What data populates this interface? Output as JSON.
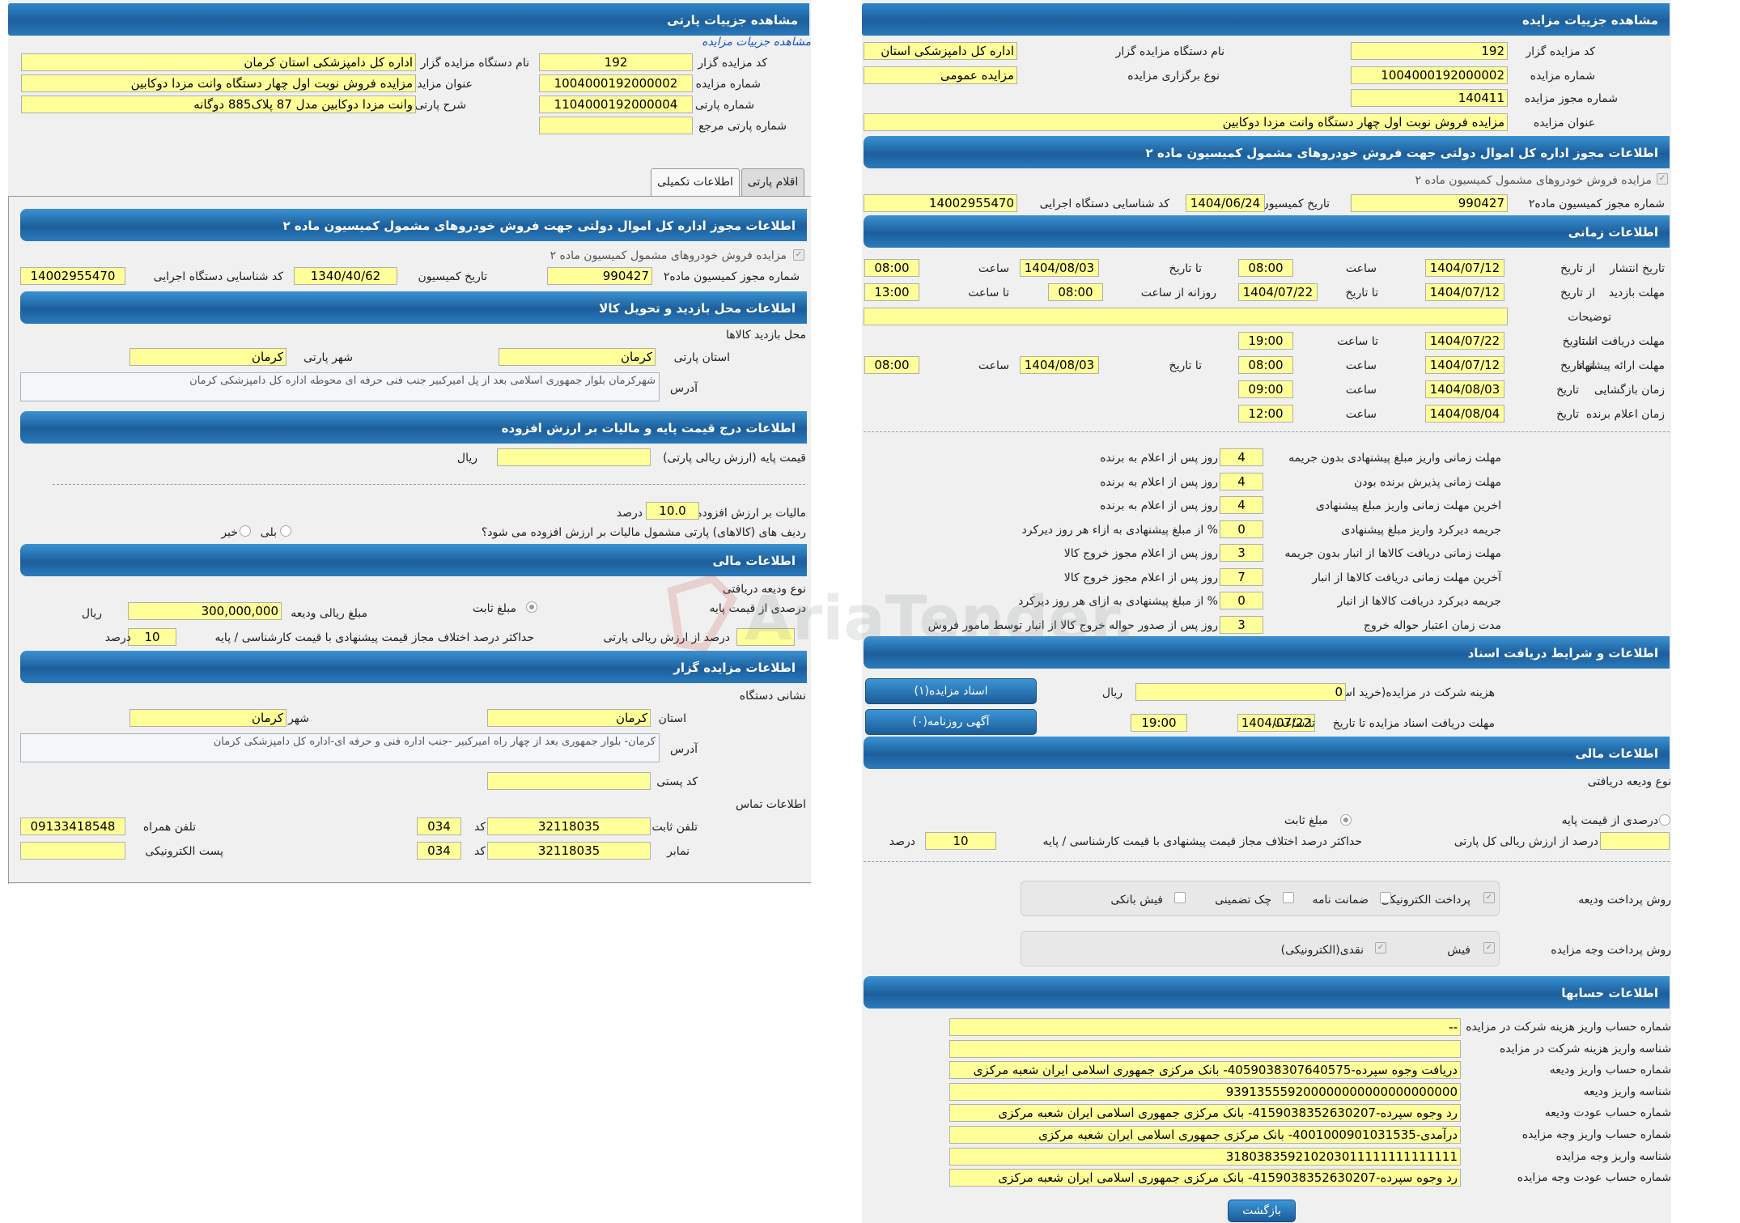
{
  "left": {
    "title": "مشاهده جزییات پارتی",
    "link": "مشاهده جزییات مزایده",
    "fields": {
      "org_name_label": "نام دستگاه مزایده گزار",
      "org_name": "اداره کل دامپزشکی استان کرمان",
      "auction_code_label": "کد مزایده گزار",
      "auction_code": "192",
      "auction_title_label": "عنوان مزایده",
      "auction_title": "مزایده فروش نوبت اول چهار دستگاه وانت مزدا دوکابین",
      "auction_no_label": "شماره مزایده",
      "auction_no": "1004000192000002",
      "party_desc_label": "شرح پارتی",
      "party_desc": "وانت مزدا دوکابین مدل 87 پلاک885 دوگانه",
      "party_no_label": "شماره پارتی",
      "party_no": "1104000192000004",
      "ref_party_label": "شماره پارتی مرجع",
      "ref_party": ""
    },
    "tabs": {
      "items": "اقلام پارتی",
      "extra": "اطلاعات تکمیلی"
    },
    "permit": {
      "header": "اطلاعات مجوز اداره کل اموال دولتی جهت فروش خودروهای مشمول کمیسیون ماده ۲",
      "check_label": "مزایده فروش خودروهای مشمول کمیسیون ماده ۲",
      "commission_no_label": "شماره مجوز کمیسیون ماده۲",
      "commission_no": "990427",
      "commission_date_label": "تاریخ کمیسیون",
      "commission_date": "1340/40/62",
      "exec_id_label": "کد شناسایی دستگاه اجرایی",
      "exec_id": "14002955470"
    },
    "visit": {
      "header": "اطلاعات محل بازدید و تحویل کالا",
      "place_label": "محل بازدید کالاها",
      "province_label": "استان پارتی",
      "province": "کرمان",
      "city_label": "شهر پارتی",
      "city": "کرمان",
      "address_label": "آدرس",
      "address": "شهرکرمان بلوار جمهوری اسلامی بعد از پل امیرکبیر جنب فنی حرفه ای محوطه اداره کل دامپزشکی کرمان"
    },
    "price": {
      "header": "اطلاعات درج قیمت پایه و مالیات بر ارزش افزوده",
      "base_label": "قیمت پایه (ارزش ریالی پارتی)",
      "base_value": "",
      "rial": "ریال",
      "vat_label": "مالیات بر ارزش افزوده",
      "vat_value": "10.0",
      "percent": "درصد",
      "vat_question": "ردیف های (کالاهای) پارتی مشمول مالیات بر ارزش افزوده می شود؟",
      "yes": "بلی",
      "no": "خیر"
    },
    "finance": {
      "header": "اطلاعات مالی",
      "deposit_type_label": "نوع ودیعه دریافتی",
      "percent_base": "درصدی از قیمت پایه",
      "fixed": "مبلغ ثابت",
      "deposit_amount_label": "مبلغ ریالی ودیعه",
      "deposit_amount": "300,000,000",
      "rial": "ریال",
      "percent_party_label": "درصد از ارزش ریالی پارتی",
      "percent_party": "",
      "max_diff_label": "حداکثر درصد اختلاف مجاز قیمت پیشنهادی با قیمت کارشناسی / پایه",
      "max_diff": "10",
      "percent": "درصد"
    },
    "org": {
      "header": "اطلاعات مزایده گزار",
      "address_title": "نشانی دستگاه",
      "province_label": "استان",
      "province": "کرمان",
      "city_label": "شهر",
      "city": "کرمان",
      "address_label": "آدرس",
      "address": "کرمان- بلوار جمهوری بعد از چهار راه امیرکبیر -جنب اداره فنی و حرفه ای-اداره کل دامپزشکی کرمان",
      "postal_label": "کد پستی",
      "postal": "",
      "contact_label": "اطلاعات تماس",
      "phone_label": "تلفن ثابت",
      "phone": "32118035",
      "code_label": "کد",
      "phone_code": "034",
      "mobile_label": "تلفن همراه",
      "mobile": "09133418548",
      "fax_label": "نمابر",
      "fax": "32118035",
      "fax_code": "034",
      "email_label": "پست الکترونیکی",
      "email": ""
    }
  },
  "right": {
    "title": "مشاهده جزییات مزایده",
    "head": {
      "code_label": "کد مزایده گزار",
      "code": "192",
      "org_label": "نام دستگاه مزایده گزار",
      "org": "اداره کل دامپزشکی استان",
      "auction_no_label": "شماره مزایده",
      "auction_no": "1004000192000002",
      "type_label": "نوع برگزاری مزایده",
      "type": "مزایده عمومی",
      "permit_no_label": "شماره مجوز مزایده",
      "permit_no": "140411",
      "title_label": "عنوان مزایده",
      "title": "مزایده فروش نوبت اول چهار دستگاه وانت مزدا دوکابین"
    },
    "permit": {
      "header": "اطلاعات مجوز اداره کل اموال دولتی جهت فروش خودروهای مشمول کمیسیون ماده ۲",
      "check_label": "مزایده فروش خودروهای مشمول کمیسیون ماده ۲",
      "commission_no_label": "شماره مجوز کمیسیون ماده۲",
      "commission_no": "990427",
      "commission_date_label": "تاریخ کمیسیون",
      "commission_date": "1404/06/24",
      "exec_id_label": "کد شناسایی دستگاه اجرایی",
      "exec_id": "14002955470"
    },
    "timing": {
      "header": "اطلاعات زمانی",
      "publish_label": "تاریخ انتشار",
      "from_date": "از تاریخ",
      "to_date": "تا تاریخ",
      "time": "ساعت",
      "to_time": "تا ساعت",
      "daily_from": "روزانه از ساعت",
      "publish_from": "1404/07/12",
      "publish_from_time": "08:00",
      "publish_to": "1404/08/03",
      "publish_to_time": "08:00",
      "visit_label": "مهلت بازدید",
      "visit_from": "1404/07/12",
      "visit_to": "1404/07/22",
      "visit_daily_from": "08:00",
      "visit_daily_to": "13:00",
      "notes_label": "توضیحات",
      "notes": "",
      "docs_label": "مهلت دریافت اسناد",
      "docs_to": "1404/07/22",
      "docs_to_time": "19:00",
      "offer_label": "مهلت ارائه پیشنهاد",
      "offer_from": "1404/07/12",
      "offer_from_time": "08:00",
      "offer_to": "1404/08/03",
      "offer_to_time": "08:00",
      "opening_label": "زمان بازگشایی",
      "date": "تاریخ",
      "opening_date": "1404/08/03",
      "opening_time": "09:00",
      "winner_label": "زمان اعلام برنده",
      "winner_date": "1404/08/04",
      "winner_time": "12:00"
    },
    "deadlines": [
      {
        "label": "مهلت زمانی واریز مبلغ پیشنهادی بدون جریمه",
        "value": "4",
        "suffix": "روز پس از اعلام به برنده"
      },
      {
        "label": "مهلت زمانی پذیرش برنده بودن",
        "value": "4",
        "suffix": "روز پس از اعلام به برنده"
      },
      {
        "label": "اخرین مهلت زمانی واریز مبلغ پیشنهادی",
        "value": "4",
        "suffix": "روز پس از اعلام به برنده"
      },
      {
        "label": "جریمه دیرکرد واریز مبلغ پیشنهادی",
        "value": "0",
        "suffix": "% از مبلغ پیشنهادی به ازاء هر روز دیرکرد"
      },
      {
        "label": "مهلت زمانی دریافت کالاها از انبار بدون جریمه",
        "value": "3",
        "suffix": "روز پس از اعلام مجوز خروج کالا"
      },
      {
        "label": "آخرین مهلت زمانی دریافت کالاها از انبار",
        "value": "7",
        "suffix": "روز پس از اعلام مجوز خروج کالا"
      },
      {
        "label": "جریمه دیرکرد دریافت کالاها از انبار",
        "value": "0",
        "suffix": "% از مبلغ پیشنهادی به ازای هر روز دیرکرد"
      },
      {
        "label": "مدت زمان اعتبار حواله خروج",
        "value": "3",
        "suffix": "روز پس از صدور حواله خروج کالا از انبار توسط مامور فروش"
      }
    ],
    "docs": {
      "header": "اطلاعات و شرایط دریافت اسناد",
      "fee_label": "هزینه شرکت در مزایده(خرید اسناد)",
      "fee": "0",
      "rial": "ریال",
      "deadline_label": "مهلت دریافت اسناد مزایده تا تاریخ",
      "deadline_date": "1404/07/22",
      "to_time": "تا ساعت",
      "deadline_time": "19:00",
      "docs_button": "اسناد مزایده(۱)",
      "ads_button": "آگهی روزنامه(۰)"
    },
    "finance": {
      "header": "اطلاعات مالی",
      "deposit_type_label": "نوع ودیعه دریافتی",
      "percent_base": "درصدی از قیمت پایه",
      "fixed": "مبلغ ثابت",
      "percent_total_label": "درصد از ارزش ریالی کل پارتی",
      "percent_total": "",
      "max_diff_label": "حداکثر درصد اختلاف مجاز قیمت پیشنهادی با قیمت کارشناسی / پایه",
      "max_diff": "10",
      "percent": "درصد",
      "deposit_method_label": "روش پرداخت ودیعه",
      "deposit_methods": [
        "پرداخت الکترونیکی",
        "ضمانت نامه",
        "چک تضمینی",
        "فیش بانکی"
      ],
      "payment_method_label": "روش پرداخت وجه مزایده",
      "payment_methods": [
        "فیش",
        "نقدی(الکترونیکی)"
      ]
    },
    "accounts": {
      "header": "اطلاعات حسابها",
      "rows": [
        {
          "label": "شماره حساب واریز هزینه شرکت در مزایده",
          "value": "--"
        },
        {
          "label": "شناسه واریز هزینه شرکت در مزایده",
          "value": ""
        },
        {
          "label": "شماره حساب واریز ودیعه",
          "value": "دریافت وجوه سپرده-4059038307640575- بانک مرکزی جمهوری اسلامی ایران شعبه مرکزی"
        },
        {
          "label": "شناسه واریز ودیعه",
          "value": "939135559200000000000000000000"
        },
        {
          "label": "شماره حساب عودت ودیعه",
          "value": "رد وجوه سپرده-4159038352630207- بانک مرکزی جمهوری اسلامی ایران شعبه مرکزی"
        },
        {
          "label": "شماره حساب واریز وجه مزایده",
          "value": "درآمدی-4001000901031535- بانک مرکزی جمهوری اسلامی ایران شعبه مرکزی"
        },
        {
          "label": "شناسه واریز وجه مزایده",
          "value": "318038359210203011111111111111"
        },
        {
          "label": "شماره حساب عودت وجه مزایده",
          "value": "رد وجوه سپرده-4159038352630207- بانک مرکزی جمهوری اسلامی ایران شعبه مرکزی"
        }
      ],
      "back_button": "بازگشت"
    }
  },
  "watermark": "AriaTender.net"
}
